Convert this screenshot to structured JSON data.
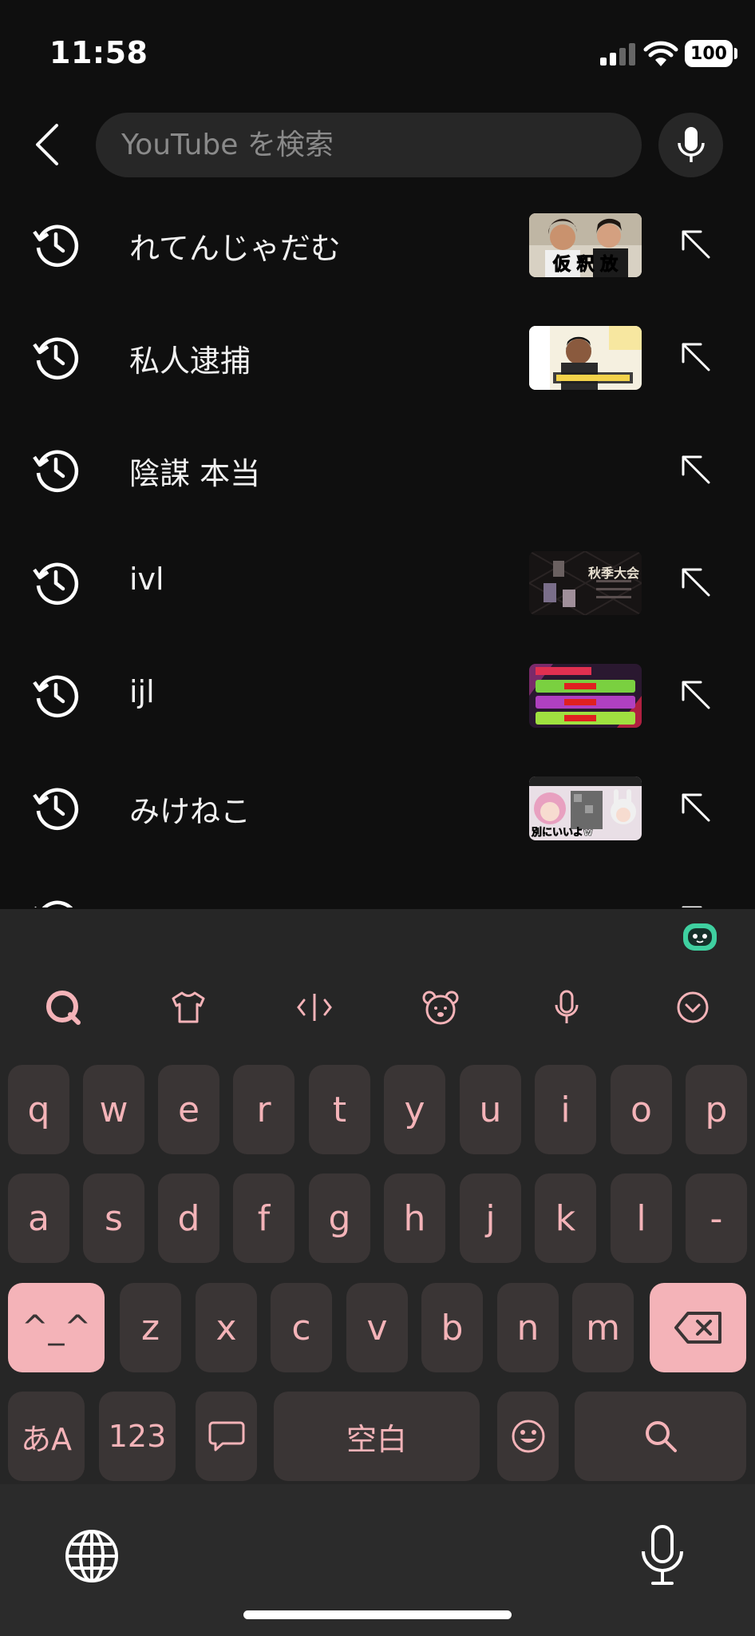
{
  "status_bar": {
    "time": "11:58",
    "battery": "100",
    "icons": [
      "signal-icon",
      "wifi-icon",
      "battery-icon"
    ]
  },
  "search": {
    "placeholder": "YouTube を検索",
    "value": ""
  },
  "history": [
    {
      "label": "れてんじゃだむ",
      "thumbnail_caption": "仮 釈 放",
      "has_thumbnail": true
    },
    {
      "label": "私人逮捕",
      "thumbnail_caption": "",
      "has_thumbnail": true
    },
    {
      "label": "陰謀 本当",
      "thumbnail_caption": "",
      "has_thumbnail": false
    },
    {
      "label": "ivl",
      "thumbnail_caption": "秋季大会",
      "has_thumbnail": true
    },
    {
      "label": "ijl",
      "thumbnail_caption": "",
      "has_thumbnail": true
    },
    {
      "label": "みけねこ",
      "thumbnail_caption": "別にいいよw",
      "has_thumbnail": true
    }
  ],
  "keyboard": {
    "accent_color": "#f4b3b8",
    "key_color": "#3a3535",
    "toolbar_icons": [
      "search-bubble-icon",
      "shirt-icon",
      "cursor-icon",
      "bear-icon",
      "microphone-icon",
      "chevron-down-circle-icon"
    ],
    "row1": [
      "q",
      "w",
      "e",
      "r",
      "t",
      "y",
      "u",
      "i",
      "o",
      "p"
    ],
    "row2": [
      "a",
      "s",
      "d",
      "f",
      "g",
      "h",
      "j",
      "k",
      "l",
      "-"
    ],
    "shift_label": "^_^",
    "row3": [
      "z",
      "x",
      "c",
      "v",
      "b",
      "n",
      "m"
    ],
    "kana_label": "あA",
    "numbers_label": "123",
    "space_label": "空白"
  }
}
